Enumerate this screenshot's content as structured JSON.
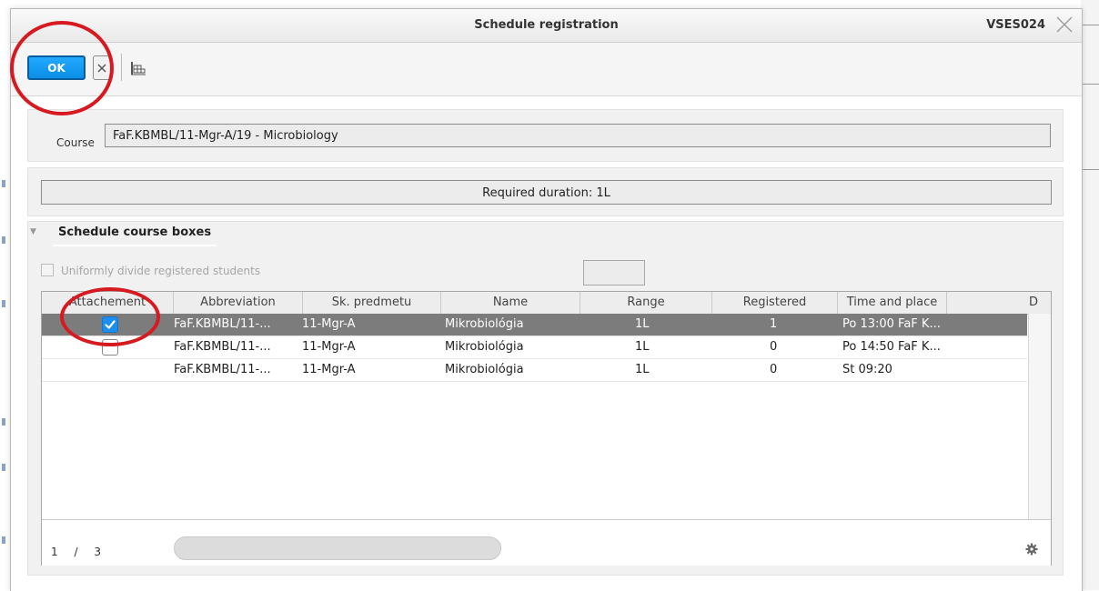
{
  "dialog": {
    "title": "Schedule registration",
    "code": "VSES024"
  },
  "toolbar": {
    "ok_label": "OK"
  },
  "course": {
    "label": "Course",
    "value": "FaF.KBMBL/11-Mgr-A/19 - Microbiology"
  },
  "duration": {
    "text": "Required duration: 1L"
  },
  "boxes": {
    "title": "Schedule course boxes",
    "uniform_label": "Uniformly divide registered students",
    "columns": [
      "Attachement",
      "Abbreviation",
      "Sk. predmetu",
      "Name",
      "Range",
      "Registered",
      "Time and place",
      "D"
    ],
    "rows": [
      {
        "checked": true,
        "abbreviation": "FaF.KBMBL/11-...",
        "sk": "11-Mgr-A",
        "name": "Mikrobiológia",
        "range": "1L",
        "registered": "1",
        "time": "Po 13:00 FaF K..."
      },
      {
        "checked": false,
        "abbreviation": "FaF.KBMBL/11-...",
        "sk": "11-Mgr-A",
        "name": "Mikrobiológia",
        "range": "1L",
        "registered": "0",
        "time": "Po 14:50 FaF K..."
      },
      {
        "checked": null,
        "abbreviation": "FaF.KBMBL/11-...",
        "sk": "11-Mgr-A",
        "name": "Mikrobiológia",
        "range": "1L",
        "registered": "0",
        "time": "St 09:20"
      }
    ],
    "pager": {
      "current": "1",
      "separator": "/",
      "total": "3"
    }
  },
  "colors": {
    "ok_button": "#0a8ee6",
    "selected_row": "#7c7c7c",
    "annotation_circle": "#d71920"
  }
}
